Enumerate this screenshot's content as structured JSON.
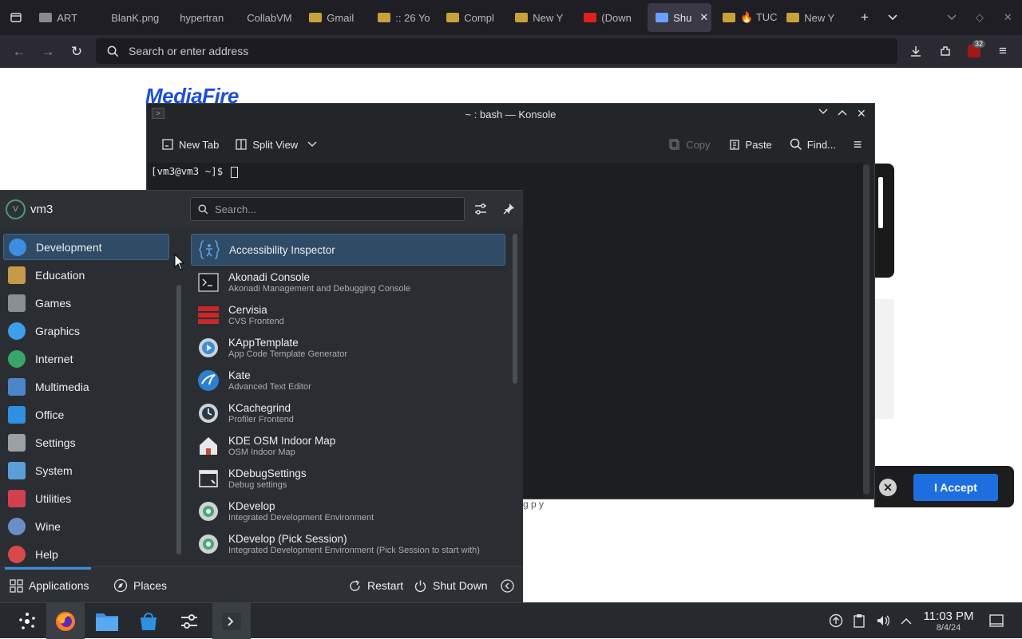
{
  "browser": {
    "tabs": [
      {
        "label": "ART",
        "favicon_color": "#8a8a8a"
      },
      {
        "label": "BlanK.png",
        "favicon_color": ""
      },
      {
        "label": "hypertran",
        "favicon_color": ""
      },
      {
        "label": "CollabVM",
        "favicon_color": ""
      },
      {
        "label": "Gmail",
        "favicon_color": "#c7a23a"
      },
      {
        "label": ":: 26 Yo",
        "favicon_color": "#c7a23a"
      },
      {
        "label": "Compl",
        "favicon_color": "#c7a23a"
      },
      {
        "label": "New Y",
        "favicon_color": "#c7a23a"
      },
      {
        "label": "(Down",
        "favicon_color": "#e02020"
      },
      {
        "label": "Shu",
        "favicon_color": "#6aa0ff",
        "active": true
      },
      {
        "label": "🔥 TUC",
        "favicon_color": "#c7a23a"
      },
      {
        "label": "New Y",
        "favicon_color": "#c7a23a"
      }
    ],
    "url_placeholder": "Search or enter address",
    "extension_badge": "32"
  },
  "page": {
    "logo": "MediaFire",
    "accept_label": "I Accept",
    "fragment_text": "g  p y"
  },
  "konsole": {
    "title": "~ : bash — Konsole",
    "toolbar": {
      "new_tab": "New Tab",
      "split_view": "Split View",
      "copy": "Copy",
      "paste": "Paste",
      "find": "Find..."
    },
    "prompt": "[vm3@vm3 ~]$ "
  },
  "launcher": {
    "user": "vm3",
    "avatar_letter": "V",
    "search_placeholder": "Search...",
    "categories": [
      {
        "label": "Development",
        "color": "#3d8ee0",
        "selected": true
      },
      {
        "label": "Education",
        "color": "#c79a4a"
      },
      {
        "label": "Games",
        "color": "#8a8f95"
      },
      {
        "label": "Graphics",
        "color": "#3d9ee8"
      },
      {
        "label": "Internet",
        "color": "#3aa56b"
      },
      {
        "label": "Multimedia",
        "color": "#4a86c8"
      },
      {
        "label": "Office",
        "color": "#2f8fe0"
      },
      {
        "label": "Settings",
        "color": "#9aa0a6"
      },
      {
        "label": "System",
        "color": "#5a9fd8"
      },
      {
        "label": "Utilities",
        "color": "#d04050"
      },
      {
        "label": "Wine",
        "color": "#6a8fc8"
      },
      {
        "label": "Help",
        "color": "#d84a4a"
      }
    ],
    "apps": [
      {
        "name": "Accessibility Inspector",
        "desc": "",
        "icon": "accessibility-icon",
        "color": "#5aa0e0",
        "selected": true
      },
      {
        "name": "Akonadi Console",
        "desc": "Akonadi Management and Debugging Console",
        "icon": "terminal-icon",
        "color": "#cfd3d7"
      },
      {
        "name": "Cervisia",
        "desc": "CVS Frontend",
        "icon": "cervisia-icon",
        "color": "#c8282a"
      },
      {
        "name": "KAppTemplate",
        "desc": "App Code Template Generator",
        "icon": "gear-play-icon",
        "color": "#3d8ee0"
      },
      {
        "name": "Kate",
        "desc": "Advanced Text Editor",
        "icon": "kate-icon",
        "color": "#2f7fd0"
      },
      {
        "name": "KCachegrind",
        "desc": "Profiler Frontend",
        "icon": "gear-clock-icon",
        "color": "#3d8ee0"
      },
      {
        "name": "KDE OSM Indoor Map",
        "desc": "OSM Indoor Map",
        "icon": "house-icon",
        "color": "#e8e8e8"
      },
      {
        "name": "KDebugSettings",
        "desc": "Debug settings",
        "icon": "debug-window-icon",
        "color": "#e8e8e8"
      },
      {
        "name": "KDevelop",
        "desc": "Integrated Development Environment",
        "icon": "kdevelop-icon",
        "color": "#4aa870"
      },
      {
        "name": "KDevelop (Pick Session)",
        "desc": "Integrated Development Environment (Pick Session to start with)",
        "icon": "kdevelop-icon",
        "color": "#4aa870"
      }
    ],
    "footer": {
      "applications": "Applications",
      "places": "Places",
      "restart": "Restart",
      "shutdown": "Shut Down"
    }
  },
  "taskbar": {
    "time": "11:03 PM",
    "date": "8/4/24"
  }
}
